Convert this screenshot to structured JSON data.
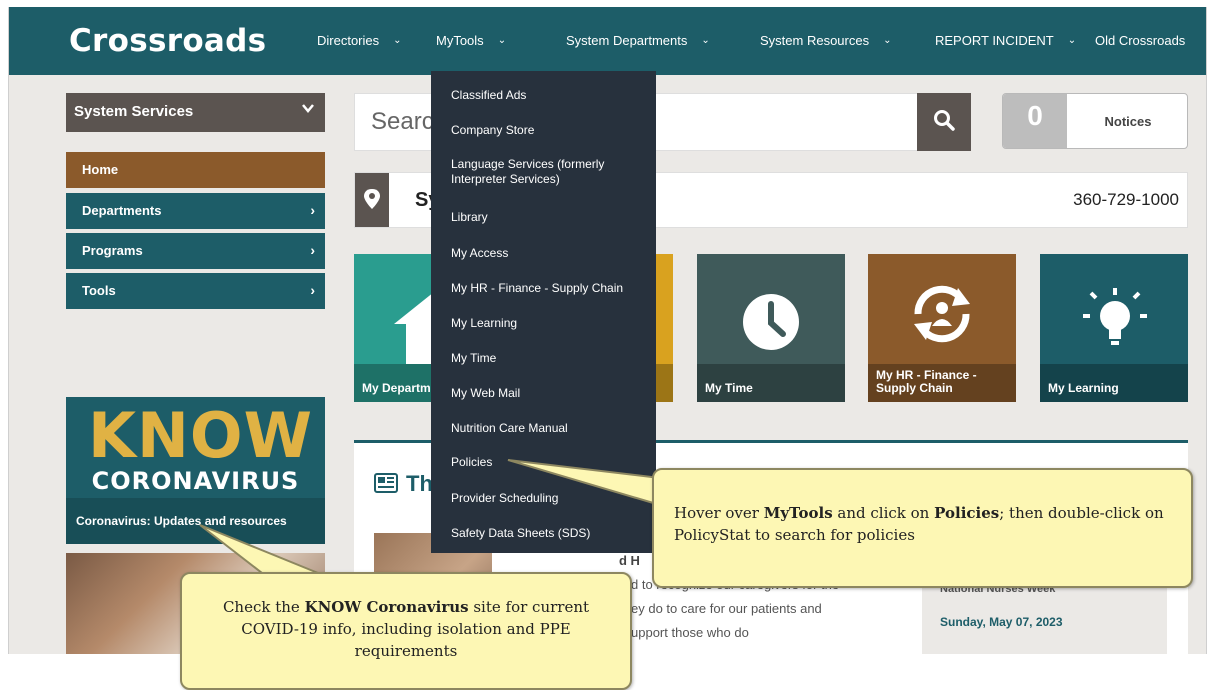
{
  "header": {
    "brand": "Crossroads",
    "nav": [
      {
        "label": "Directories",
        "chevron": "⌄"
      },
      {
        "label": "MyTools",
        "chevron": "⌄"
      },
      {
        "label": "System Departments",
        "chevron": "⌄"
      },
      {
        "label": "System Resources",
        "chevron": "⌄"
      },
      {
        "label": "REPORT INCIDENT",
        "chevron": "⌄"
      },
      {
        "label": "Old Crossroads",
        "chevron": ""
      }
    ]
  },
  "sidebar": {
    "dropdown_label": "System Services",
    "items": [
      {
        "label": "Home"
      },
      {
        "label": "Departments"
      },
      {
        "label": "Programs"
      },
      {
        "label": "Tools"
      }
    ]
  },
  "search": {
    "placeholder": "Search"
  },
  "notices": {
    "count": "0",
    "label": "Notices"
  },
  "location": {
    "name": "Sy",
    "phone": "360-729-1000"
  },
  "tiles": [
    {
      "label": "My Departments",
      "color": "#2a9d8f",
      "icon": "home-icon"
    },
    {
      "label": "",
      "color": "#d9a21f",
      "icon": "tile-icon"
    },
    {
      "label": "My Time",
      "color": "#3f5a5a",
      "icon": "clock-icon"
    },
    {
      "label": "My HR - Finance - Supply Chain",
      "color": "#8b5a2b",
      "icon": "hr-cycle-icon"
    },
    {
      "label": "My Learning",
      "color": "#1d5d68",
      "icon": "lightbulb-icon"
    }
  ],
  "covid": {
    "know": "KNOW",
    "coronavirus": "CORONAVIRUS",
    "link": "Coronavirus: Updates and resources"
  },
  "news": {
    "heading": "Th",
    "snippet_title": "d H",
    "snippet_lines": [
      "d to recognize our caregivers for the",
      "ey do to care for our patients and",
      "upport those who do"
    ],
    "side_title": "National Nurses Week",
    "side_date": "Sunday, May 07, 2023"
  },
  "mytools_menu": [
    "Classified Ads",
    "Company Store",
    "Language Services (formerly Interpreter Services)",
    "Library",
    "My Access",
    "My HR - Finance - Supply Chain",
    "My Learning",
    "My Time",
    "My Web Mail",
    "Nutrition Care Manual",
    "Policies",
    "Provider Scheduling",
    "Safety Data Sheets (SDS)"
  ],
  "callouts": {
    "policies": {
      "pre1": "Hover over ",
      "b1": "MyTools",
      "mid1": " and click on ",
      "b2": "Policies",
      "post1": "; then double-click on PolicyStat to search for policies"
    },
    "covid": {
      "pre": "Check the ",
      "b": "KNOW Coronavirus",
      "post": " site for current COVID-19 info, including isolation and PPE requirements"
    }
  }
}
